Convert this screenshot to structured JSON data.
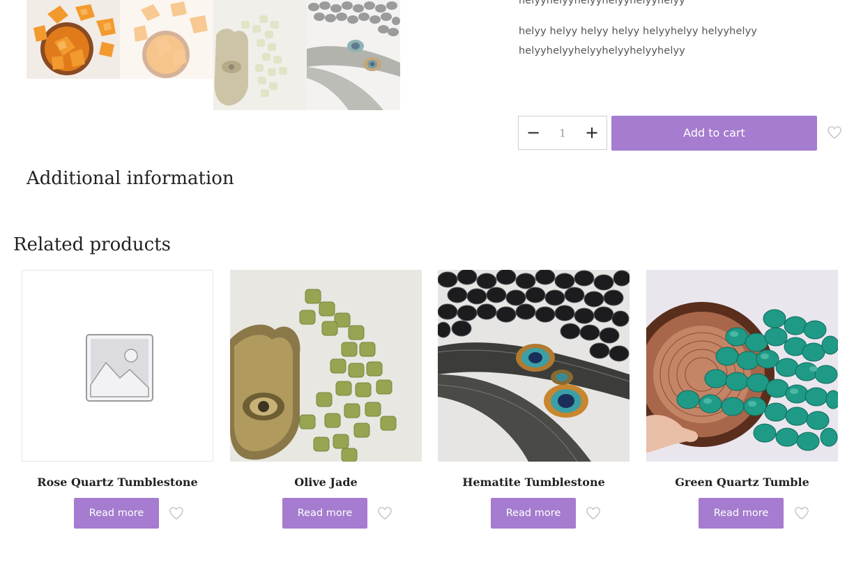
{
  "product": {
    "description_lines": [
      "helyyhelyyhelyyhelyyhelyyhelyy",
      "helyy helyy helyy helyy helyyhelyy helyyhelyy",
      "helyyhelyyhelyyhelyyhelyyhelyy"
    ],
    "quantity": "1",
    "qty_minus": "−",
    "qty_plus": "+",
    "add_to_cart": "Add to cart",
    "wishlist_icon": "heart-outline-icon"
  },
  "gallery": {
    "thumbnails": [
      "citrine",
      "citrine",
      "olive jade",
      "hematite"
    ]
  },
  "additional_information": "Additional information",
  "related": {
    "heading": "Related products",
    "products": [
      {
        "title": "Rose Quartz Tumblestone",
        "button": "Read more",
        "image": "placeholder"
      },
      {
        "title": "Olive Jade",
        "button": "Read more",
        "image": "olive-jade"
      },
      {
        "title": "Hematite Tumblestone",
        "button": "Read more",
        "image": "hematite"
      },
      {
        "title": "Green Quartz Tumble",
        "button": "Read more",
        "image": "green-quartz"
      }
    ]
  },
  "colors": {
    "accent": "#a57ccf",
    "text": "#222222",
    "muted": "#555555"
  }
}
